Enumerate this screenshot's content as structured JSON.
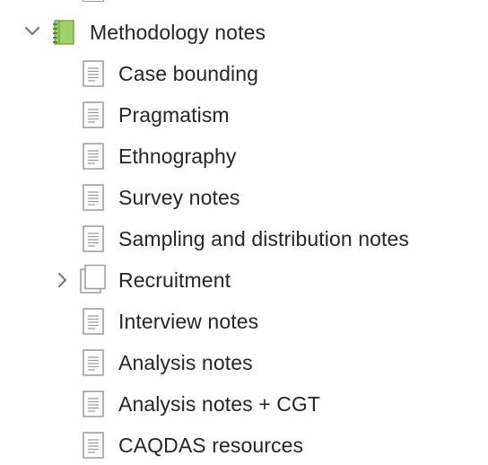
{
  "binder": {
    "group": {
      "label": "Methodology notes",
      "icon": "notebook-icon",
      "expanded": true
    },
    "items": [
      {
        "label": "Case bounding",
        "icon": "document-icon"
      },
      {
        "label": "Pragmatism",
        "icon": "document-icon"
      },
      {
        "label": "Ethnography",
        "icon": "document-icon"
      },
      {
        "label": "Survey notes",
        "icon": "document-icon"
      },
      {
        "label": "Sampling and distribution notes",
        "icon": "document-icon"
      },
      {
        "label": "Recruitment",
        "icon": "stacked-documents-icon",
        "expandable": true,
        "expanded": false
      },
      {
        "label": "Interview notes",
        "icon": "document-icon"
      },
      {
        "label": "Analysis notes",
        "icon": "document-icon"
      },
      {
        "label": "Analysis notes + CGT",
        "icon": "document-icon"
      },
      {
        "label": "CAQDAS resources",
        "icon": "document-icon"
      }
    ],
    "colors": {
      "notebook_fill": "#9fd06a",
      "notebook_stroke": "#5f9a2c",
      "doc_stroke": "#9a9a9a",
      "chevron": "#7a7a7a",
      "text": "#262626"
    }
  }
}
